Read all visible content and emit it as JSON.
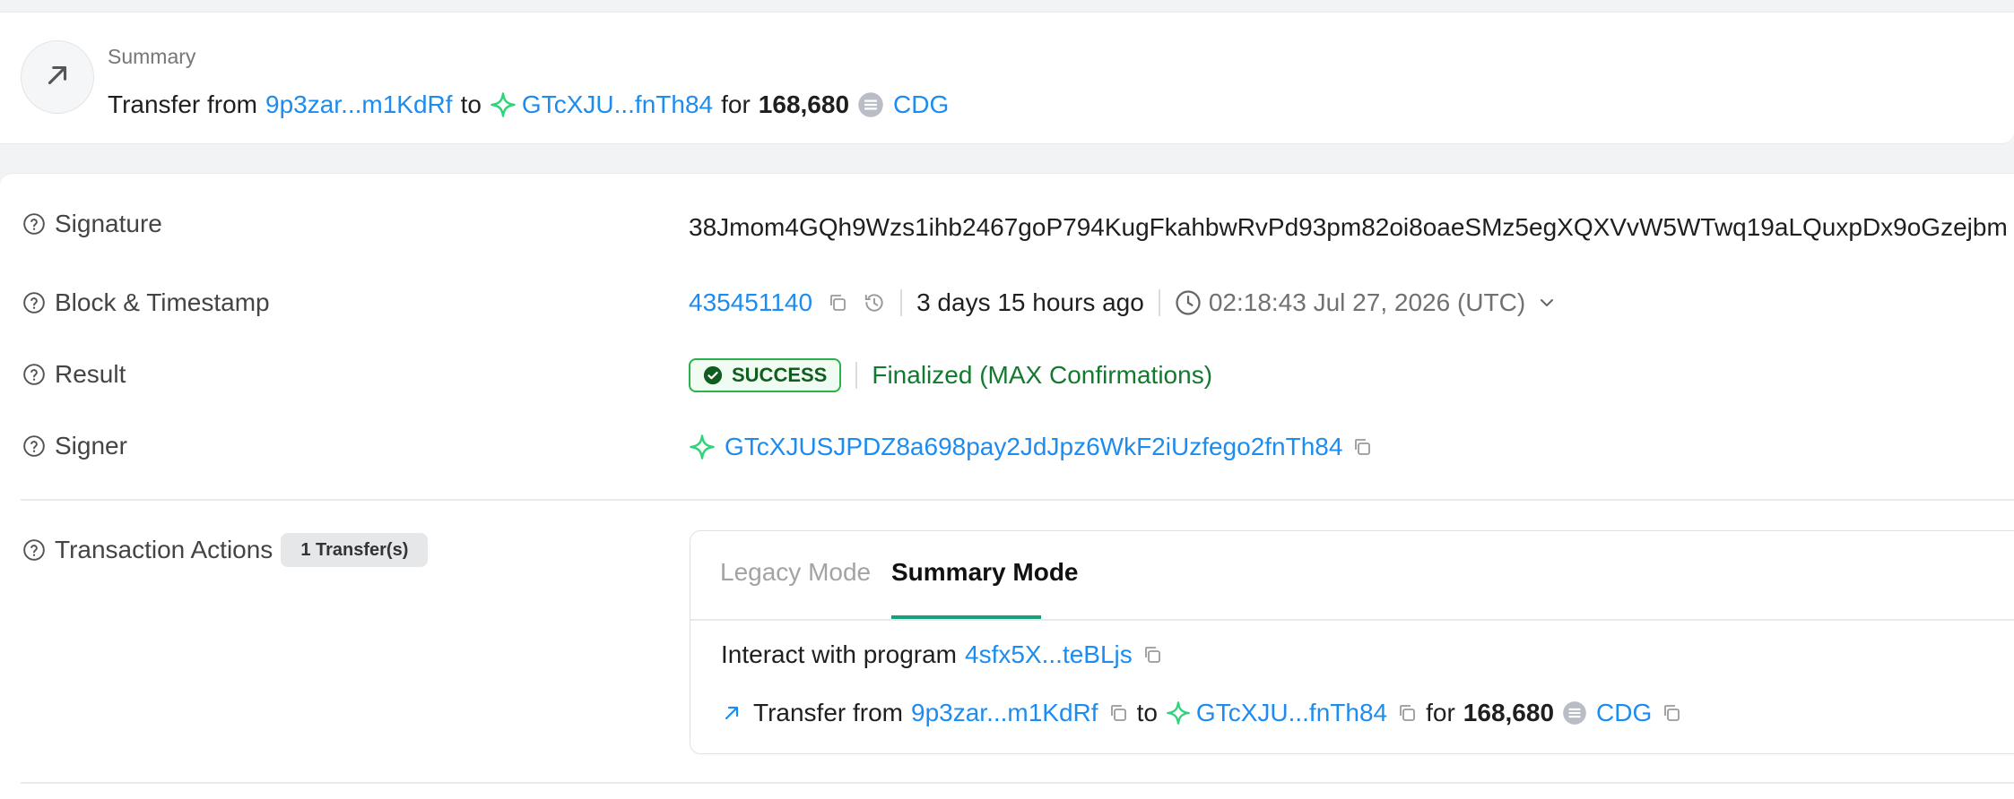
{
  "summary": {
    "label": "Summary",
    "transfer_from_text": "Transfer from",
    "from_address": "9p3zar...m1KdRf",
    "to_text": "to",
    "to_address": "GTcXJU...fnTh84",
    "for_text": "for",
    "amount": "168,680",
    "token": "CDG"
  },
  "rows": {
    "signature": {
      "label": "Signature",
      "value": "38Jmom4GQh9Wzs1ihb2467goP794KugFkahbwRvPd93pm82oi8oaeSMz5egXQXVvW5WTwq19aLQuxpDx9oGzejbm"
    },
    "block": {
      "label": "Block & Timestamp",
      "block_number": "435451140",
      "relative_time": "3 days 15 hours ago",
      "timestamp": "02:18:43 Jul 27, 2026 (UTC)"
    },
    "result": {
      "label": "Result",
      "status": "SUCCESS",
      "finality": "Finalized (MAX Confirmations)"
    },
    "signer": {
      "label": "Signer",
      "address": "GTcXJUSJPDZ8a698pay2JdJpz6WkF2iUzfego2fnTh84"
    },
    "actions": {
      "label": "Transaction Actions",
      "count_badge": "1 Transfer(s)"
    }
  },
  "actions_panel": {
    "tabs": [
      "Legacy Mode",
      "Summary Mode"
    ],
    "active_tab": "Summary Mode",
    "interact_text": "Interact with program",
    "program": "4sfx5X...teBLjs",
    "transfer_from_text": "Transfer from",
    "from_address": "9p3zar...m1KdRf",
    "to_text": "to",
    "to_address": "GTcXJU...fnTh84",
    "for_text": "for",
    "amount": "168,680",
    "token": "CDG"
  },
  "colors": {
    "link": "#1d8cf0",
    "success": "#2bb24c",
    "tab_active": "#16a07c",
    "sparkle": "#2ed47a"
  },
  "icons": [
    "arrow-up-right-icon",
    "sparkle-icon",
    "token-icon",
    "help-icon",
    "copy-icon",
    "history-icon",
    "clock-icon",
    "chevron-down-icon",
    "check-circle-icon"
  ]
}
